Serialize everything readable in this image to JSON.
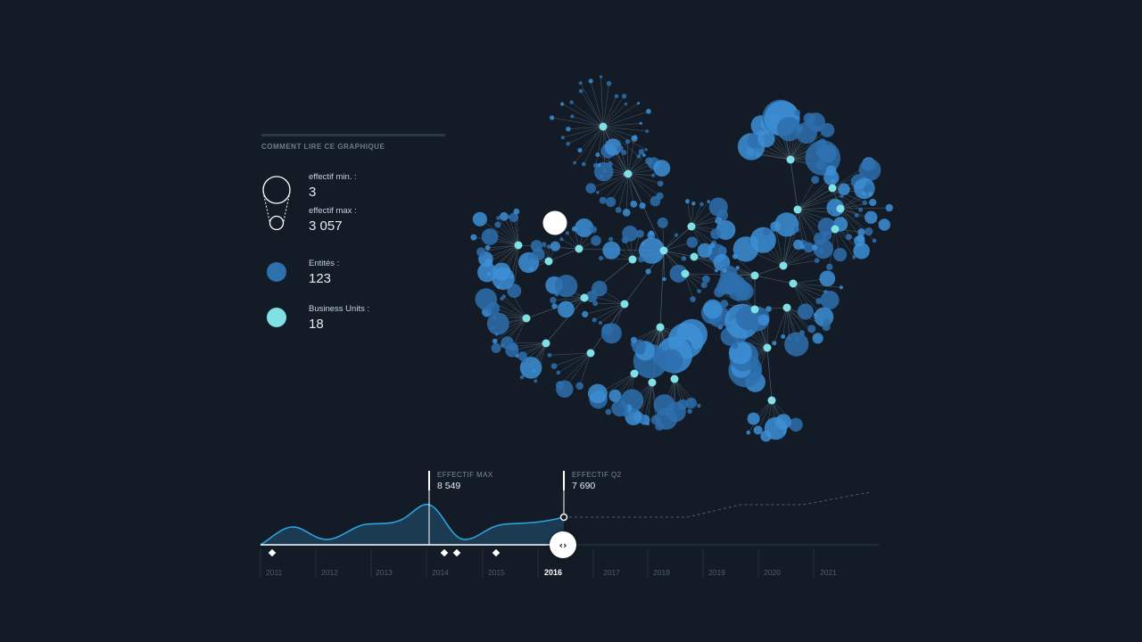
{
  "legend": {
    "heading": "COMMENT LIRE CE GRAPHIQUE",
    "min_label": "effectif min. :",
    "min_value": "3",
    "max_label": "effectif max :",
    "max_value": "3 057",
    "entities_label": "Entités :",
    "entities_value": "123",
    "bu_label": "Business Units :",
    "bu_value": "18"
  },
  "colors": {
    "background": "#131c26",
    "entity": "#2e6fae",
    "entity_light": "#3d8fd6",
    "business_unit": "#7fe0e6",
    "link": "#6f8595",
    "timeline_line": "#2ea1e0",
    "timeline_fill": "#1d3f58",
    "highlight": "#ffffff"
  },
  "timeline": {
    "annotations": [
      {
        "label": "EFFECTIF MAX",
        "value": "8 549"
      },
      {
        "label": "EFFECTIF Q2",
        "value": "7 690"
      }
    ],
    "years": [
      "2011",
      "2012",
      "2013",
      "2014",
      "2015",
      "2016",
      "2017",
      "2018",
      "2019",
      "2020",
      "2021"
    ],
    "active_year": "2016",
    "scrubber_icon": "‹›"
  },
  "chart_data": [
    {
      "type": "network",
      "node_types": [
        "Entités",
        "Business Units"
      ],
      "entities_count": 123,
      "business_units_count": 18,
      "min_headcount": 3,
      "max_headcount": 3057
    },
    {
      "type": "area",
      "x": [
        "2011",
        "2012",
        "2013",
        "2014",
        "2015",
        "2016"
      ],
      "max_point": {
        "label": "EFFECTIF MAX",
        "value": 8549
      },
      "current_point": {
        "label": "EFFECTIF Q2",
        "value": 7690
      },
      "projection": "dashed"
    }
  ]
}
